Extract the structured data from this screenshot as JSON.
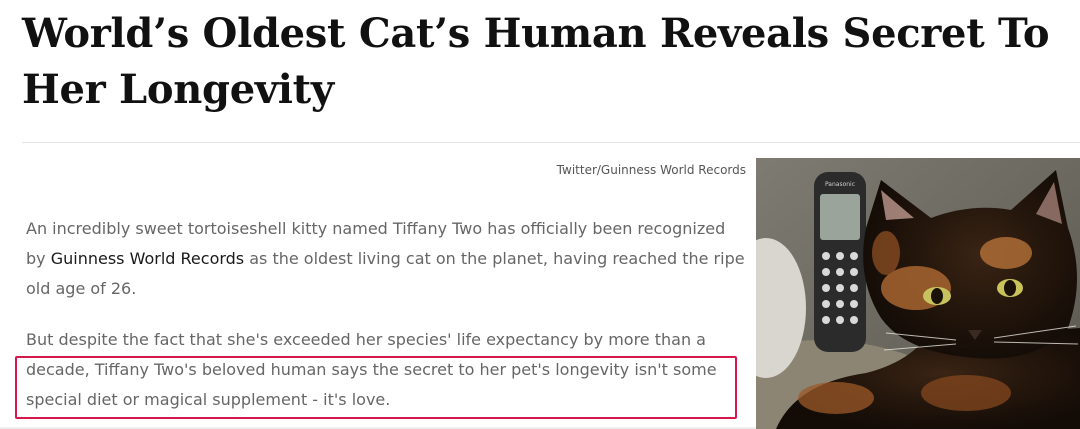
{
  "article": {
    "headline": "World’s Oldest Cat’s Human Reveals Secret To Her Longevity",
    "image_credit": "Twitter/Guinness World Records",
    "paragraph1": {
      "before_link": "An incredibly sweet tortoiseshell kitty named Tiffany Two has officially been recognized by ",
      "link_text": "Guinness World Records",
      "after_link": " as the oldest living cat on the planet, having reached the ripe old age of 26."
    },
    "paragraph2": "But despite the fact that she's exceeded her species' life expectancy by more than a decade, Tiffany Two's beloved human says the secret to her pet's longevity isn't some special diet or magical supplement - it's love."
  },
  "photo": {
    "subject": "tortoiseshell cat beside cordless phone",
    "phone_brand": "Panasonic"
  },
  "colors": {
    "highlight_border": "#d6194d",
    "body_text": "#666666",
    "headline_text": "#111111"
  }
}
